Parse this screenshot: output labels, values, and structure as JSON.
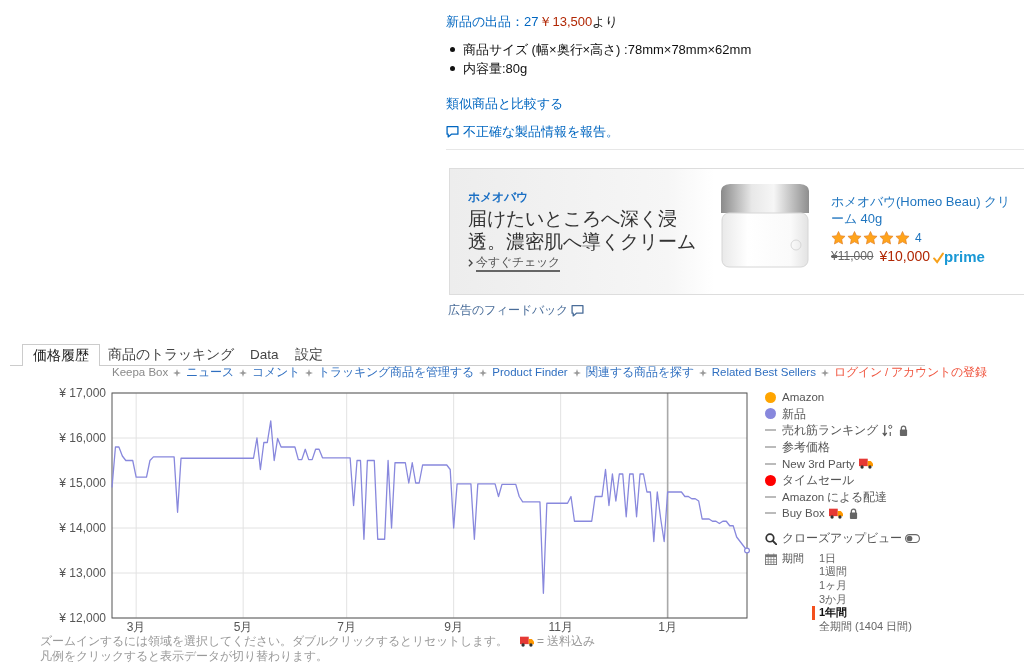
{
  "offers": {
    "label": "新品の出品：",
    "count": "27",
    "price": "￥13,500",
    "suffix": "より"
  },
  "features": [
    "商品サイズ (幅×奥行×高さ) :78mm×78mm×62mm",
    "内容量:80g"
  ],
  "compare_link": "類似商品と比較する",
  "report_link": "不正確な製品情報を報告。",
  "ad": {
    "brand": "ホメオバウ",
    "headline": "届けたいところへ深く浸透。濃密肌へ導くクリーム",
    "cta": "今すぐチェック",
    "product_title": "ホメオバウ(Homeo Beau) クリーム 40g",
    "stars": 5,
    "review_count": "4",
    "list_price": "¥11,000",
    "price": "¥10,000",
    "badge": "prime"
  },
  "ad_feedback": "広告のフィードバック",
  "tabs": [
    {
      "label": "価格履歴",
      "selected": true
    },
    {
      "label": "商品のトラッキング",
      "selected": false
    },
    {
      "label": "Data",
      "selected": false
    },
    {
      "label": "設定",
      "selected": false
    }
  ],
  "links": [
    {
      "label": "Keepa Box",
      "kind": "plain"
    },
    {
      "label": "ニュース",
      "kind": "link"
    },
    {
      "label": "コメント",
      "kind": "link"
    },
    {
      "label": "トラッキング商品を管理する",
      "kind": "link"
    },
    {
      "label": "Product Finder",
      "kind": "link"
    },
    {
      "label": "関連する商品を探す",
      "kind": "link"
    },
    {
      "label": "Related Best Sellers",
      "kind": "link"
    },
    {
      "label": "ログイン / アカウントの登録",
      "kind": "account"
    }
  ],
  "chart": {
    "chart_data": {
      "type": "line",
      "categories": [
        null,
        null,
        null,
        null,
        null,
        null,
        null,
        "3月",
        null,
        null,
        null,
        null,
        null,
        null,
        null,
        null,
        null,
        null,
        null,
        null,
        null,
        null,
        null,
        null,
        null,
        null,
        null,
        null,
        null,
        null,
        null,
        null,
        null,
        null,
        null,
        null,
        null,
        null,
        "5月",
        null,
        null,
        null,
        null,
        null,
        null,
        null,
        null,
        null,
        null,
        null,
        null,
        null,
        null,
        null,
        null,
        null,
        null,
        null,
        null,
        null,
        null,
        null,
        null,
        null,
        null,
        null,
        null,
        null,
        "7月",
        null,
        null,
        null,
        null,
        null,
        null,
        null,
        null,
        null,
        null,
        null,
        null,
        null,
        null,
        null,
        null,
        null,
        null,
        null,
        null,
        null,
        null,
        null,
        null,
        null,
        null,
        null,
        null,
        null,
        null,
        "9月",
        null,
        null,
        null,
        null,
        null,
        null,
        null,
        null,
        null,
        null,
        null,
        null,
        null,
        null,
        null,
        null,
        null,
        null,
        null,
        null,
        null,
        null,
        null,
        null,
        null,
        null,
        null,
        null,
        null,
        null,
        "11月",
        null,
        null,
        null,
        null,
        null,
        null,
        null,
        null,
        null,
        null,
        null,
        null,
        null,
        null,
        null,
        null,
        null,
        null,
        null,
        null,
        null,
        null,
        null,
        null,
        null,
        null,
        null,
        null,
        null,
        null,
        "1月",
        null,
        null,
        null,
        null,
        null,
        null,
        null,
        null,
        null,
        null,
        null,
        null,
        null,
        null,
        null,
        null,
        null,
        null,
        null,
        null,
        null,
        null,
        null
      ],
      "series": [
        {
          "color": "#8888dd",
          "values": [
            14900,
            15800,
            15800,
            15600,
            15500,
            15500,
            15500,
            15130,
            15130,
            15130,
            15130,
            15500,
            15580,
            15580,
            15580,
            15580,
            15580,
            15580,
            15580,
            14350,
            15550,
            15550,
            15550,
            15550,
            15550,
            15550,
            15550,
            15550,
            15550,
            15550,
            15550,
            15550,
            15550,
            15550,
            15550,
            15550,
            15550,
            15550,
            15550,
            15550,
            15550,
            15550,
            16000,
            15300,
            15900,
            15900,
            16380,
            15500,
            15990,
            15800,
            15800,
            15800,
            15800,
            15800,
            15520,
            15520,
            15750,
            15520,
            15520,
            15750,
            15750,
            15560,
            15560,
            15560,
            15560,
            15560,
            15560,
            15560,
            15560,
            15560,
            14500,
            15500,
            15500,
            13750,
            15500,
            15500,
            15500,
            13750,
            13750,
            13750,
            15500,
            14000,
            15450,
            15450,
            15450,
            15450,
            15000,
            15450,
            15000,
            15000,
            15400,
            15400,
            15400,
            15400,
            15400,
            15400,
            15400,
            15400,
            15300,
            14000,
            14980,
            14980,
            14980,
            14980,
            14980,
            13750,
            14980,
            14980,
            14980,
            14980,
            14980,
            14980,
            14700,
            14970,
            14970,
            14970,
            14970,
            14970,
            14700,
            14580,
            14580,
            14580,
            14580,
            14580,
            14580,
            12550,
            14550,
            14550,
            14550,
            14550,
            14550,
            14550,
            14550,
            14700,
            14150,
            14150,
            14150,
            14150,
            14150,
            14150,
            14700,
            14700,
            14700,
            15300,
            14500,
            15200,
            14600,
            15200,
            15200,
            14250,
            15200,
            15200,
            14250,
            15200,
            15200,
            14800,
            14800,
            13700,
            14800,
            14200,
            13700,
            14800,
            14800,
            14800,
            14800,
            14800,
            14700,
            14700,
            14650,
            14650,
            14600,
            14200,
            14200,
            14200,
            14150,
            14150,
            14100,
            14150,
            14150,
            14050,
            14050,
            13800,
            13700,
            13600,
            13500
          ]
        }
      ],
      "ylim": [
        12000,
        17000
      ],
      "yticks": [
        {
          "value": 12000,
          "label": "¥ 12,000"
        },
        {
          "value": 13000,
          "label": "¥ 13,000"
        },
        {
          "value": 14000,
          "label": "¥ 14,000"
        },
        {
          "value": 15000,
          "label": "¥ 15,000"
        },
        {
          "value": 16000,
          "label": "¥ 16,000"
        },
        {
          "value": 17000,
          "label": "¥ 17,000"
        }
      ],
      "grid": true,
      "ref_lines": [
        {
          "axis": "x",
          "value": "1月"
        }
      ]
    }
  },
  "legend": [
    {
      "label": "Amazon",
      "kind": "dot",
      "color": "#ffa500",
      "sortable": false,
      "shipping_included": false,
      "locked": false
    },
    {
      "label": "新品",
      "kind": "dot",
      "color": "#8888dd",
      "sortable": false,
      "shipping_included": false,
      "locked": false
    },
    {
      "label": "売れ筋ランキング",
      "kind": "dash",
      "sortable": true,
      "shipping_included": false,
      "locked": true
    },
    {
      "label": "参考価格",
      "kind": "dash",
      "sortable": false,
      "shipping_included": false,
      "locked": false
    },
    {
      "label": "New 3rd Party",
      "kind": "dash",
      "sortable": false,
      "shipping_included": true,
      "locked": false
    },
    {
      "label": "タイムセール",
      "kind": "dot",
      "color": "#ff0000",
      "sortable": false,
      "shipping_included": false,
      "locked": false
    },
    {
      "label": "Amazon による配達",
      "kind": "dash",
      "sortable": false,
      "shipping_included": false,
      "locked": false
    },
    {
      "label": "Buy Box",
      "kind": "dash",
      "sortable": false,
      "shipping_included": true,
      "locked": true
    }
  ],
  "closeup_view": {
    "label": "クローズアップビュー",
    "on": false
  },
  "period": {
    "label": "期間",
    "options": [
      {
        "label": "1日",
        "selected": false
      },
      {
        "label": "1週間",
        "selected": false
      },
      {
        "label": "1ヶ月",
        "selected": false
      },
      {
        "label": "3か月",
        "selected": false
      },
      {
        "label": "1年間",
        "selected": true
      },
      {
        "label": "全期間 (1404 日間)",
        "selected": false
      }
    ]
  },
  "notes": {
    "zoom_hint": "ズームインするには領域を選択してください。ダブルクリックするとリセットします。",
    "shipping_key": "= 送料込み",
    "legend_hint": "凡例をクリックすると表示データが切り替わります。"
  }
}
